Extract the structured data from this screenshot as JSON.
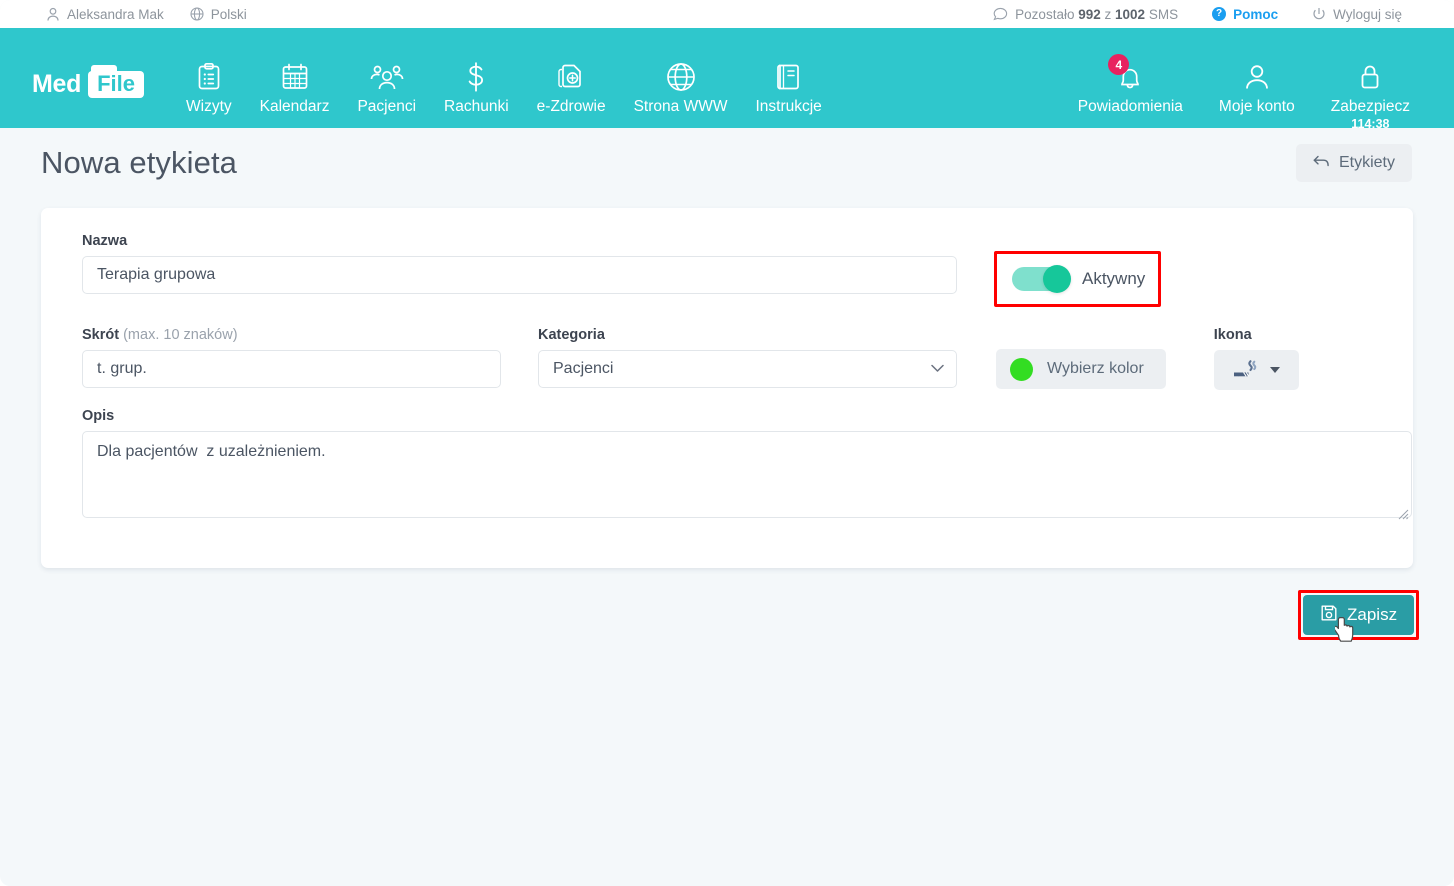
{
  "topbar": {
    "user_icon": "user-icon",
    "user_name": "Aleksandra Mak",
    "lang_icon": "globe-icon",
    "language": "Polski",
    "sms_icon": "chat-bubble-icon",
    "sms_prefix": "Pozostało ",
    "sms_used": "992",
    "sms_mid": " z ",
    "sms_total": "1002",
    "sms_suffix": " SMS",
    "help_label": "Pomoc",
    "help_icon": "question-circle-icon",
    "logout_icon": "power-icon",
    "logout_label": "Wyloguj się"
  },
  "brand": {
    "part1": "Med",
    "part2": "File"
  },
  "nav": {
    "items": [
      {
        "label": "Wizyty",
        "icon": "clipboard-list-icon"
      },
      {
        "label": "Kalendarz",
        "icon": "calendar-icon"
      },
      {
        "label": "Pacjenci",
        "icon": "users-icon"
      },
      {
        "label": "Rachunki",
        "icon": "dollar-icon"
      },
      {
        "label": "e-Zdrowie",
        "icon": "file-medical-icon"
      },
      {
        "label": "Strona WWW",
        "icon": "globe-icon"
      },
      {
        "label": "Instrukcje",
        "icon": "book-icon"
      }
    ],
    "right": {
      "notifications_label": "Powiadomienia",
      "notifications_icon": "bell-icon",
      "notifications_badge": "4",
      "account_label": "Moje konto",
      "account_icon": "user-circle-icon",
      "secure_label": "Zabezpiecz",
      "secure_icon": "lock-icon",
      "secure_timer": "114:38"
    }
  },
  "page": {
    "title": "Nowa etykieta",
    "back_button": {
      "label": "Etykiety",
      "icon": "arrow-back-icon"
    }
  },
  "form": {
    "name": {
      "label": "Nazwa",
      "value": "Terapia grupowa",
      "placeholder": ""
    },
    "active_toggle": {
      "label": "Aktywny",
      "state": "on"
    },
    "short": {
      "label": "Skrót",
      "label_hint": " (max. 10 znaków)",
      "value": "t. grup.",
      "placeholder": ""
    },
    "category": {
      "label": "Kategoria",
      "selected": "Pacjenci",
      "options": [
        "Pacjenci"
      ],
      "chevron_icon": "chevron-down-icon"
    },
    "color": {
      "label": "Wybierz kolor",
      "value": "#33dd22",
      "dot_icon": "color-swatch-icon"
    },
    "icon_picker": {
      "label": "Ikona",
      "selected_icon": "smoking-icon",
      "caret_icon": "caret-down-icon"
    },
    "description": {
      "label": "Opis",
      "value": "Dla pacjentów  z uzależnieniem.",
      "placeholder": ""
    }
  },
  "actions": {
    "save": {
      "label": "Zapisz",
      "icon": "save-floppy-icon"
    }
  },
  "colors": {
    "teal_nav": "#2fc7cc",
    "teal_button": "#2a9da5",
    "badge_pink": "#e8225f",
    "highlight_red": "#ff0000",
    "toggle_on": "#16c79a",
    "page_bg": "#f4f8fa",
    "help_blue": "#1a9ef0"
  }
}
